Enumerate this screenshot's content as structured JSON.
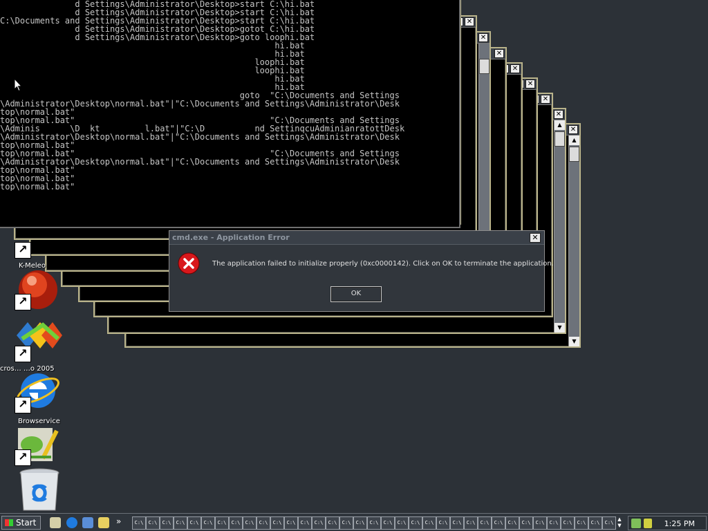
{
  "console": {
    "text": "               d Settings\\Administrator\\Desktop>start C:\\hi.bat\n               d Settings\\Administrator\\Desktop>start C:\\hi.bat\nC:\\Documents and Settings\\Administrator\\Desktop>start C:\\hi.bat\n               d Settings\\Administrator\\Desktop>gotot C:\\hi.bat\n               d Settings\\Administrator\\Desktop>goto loophi.bat\n                                                       hi.bat\n                                                       hi.bat\n                                                   loophi.bat\n                                                   loophi.bat\n                                                       hi.bat\n                                                       hi.bat\n                                                goto  \"C:\\Documents and Settings\n\\Administrator\\Desktop\\normal.bat\"|\"C:\\Documents and Settings\\Administrator\\Desk\ntop\\normal.bat\"\ntop\\normal.bat\"                                       \"C:\\Documents and Settings\n\\Adminis      \\D  kt         l.bat\"|\"C:\\D          nd SettinqcuAdminianratottDesk\n\\Administrator\\Desktop\\normal.bat\"|\"C:\\Documents and Settings\\Administrator\\Desk\ntop\\normal.bat\"\ntop\\normal.bat\"                                       \"C:\\Documents and Settings\n\\Administrator\\Desktop\\normal.bat\"|\"C:\\Documents and Settings\\Administrator\\Desk\ntop\\normal.bat\"\ntop\\normal.bat\"\ntop\\normal.bat\""
  },
  "dialog": {
    "title": "cmd.exe - Application Error",
    "message": "The application failed to initialize properly (0xc0000142). Click on OK to terminate the application.",
    "ok_label": "OK",
    "close_glyph": "✕"
  },
  "window_controls": {
    "minimize": "_",
    "maximize": "□",
    "close": "✕"
  },
  "desktop_icons": [
    {
      "label": "K-Meleo",
      "icon": "k-meleon-icon"
    },
    {
      "label": "",
      "icon": "visual-studio-icon"
    },
    {
      "label": "cros…  …o 2005",
      "icon": "internet-explorer-icon"
    },
    {
      "label": "Browservice",
      "icon": "browservice-icon"
    },
    {
      "label": "",
      "icon": "recycle-bin-icon"
    }
  ],
  "taskbar": {
    "start_label": "Start",
    "task_button_label": "C:\\",
    "task_button_count": 35,
    "clock": "1:25 PM",
    "overflow_glyph": "»"
  },
  "colors": {
    "desktop": "#2c3137",
    "console_text": "#c6c6c6",
    "error_red": "#d8181c",
    "window_border": "#b9b38a"
  }
}
